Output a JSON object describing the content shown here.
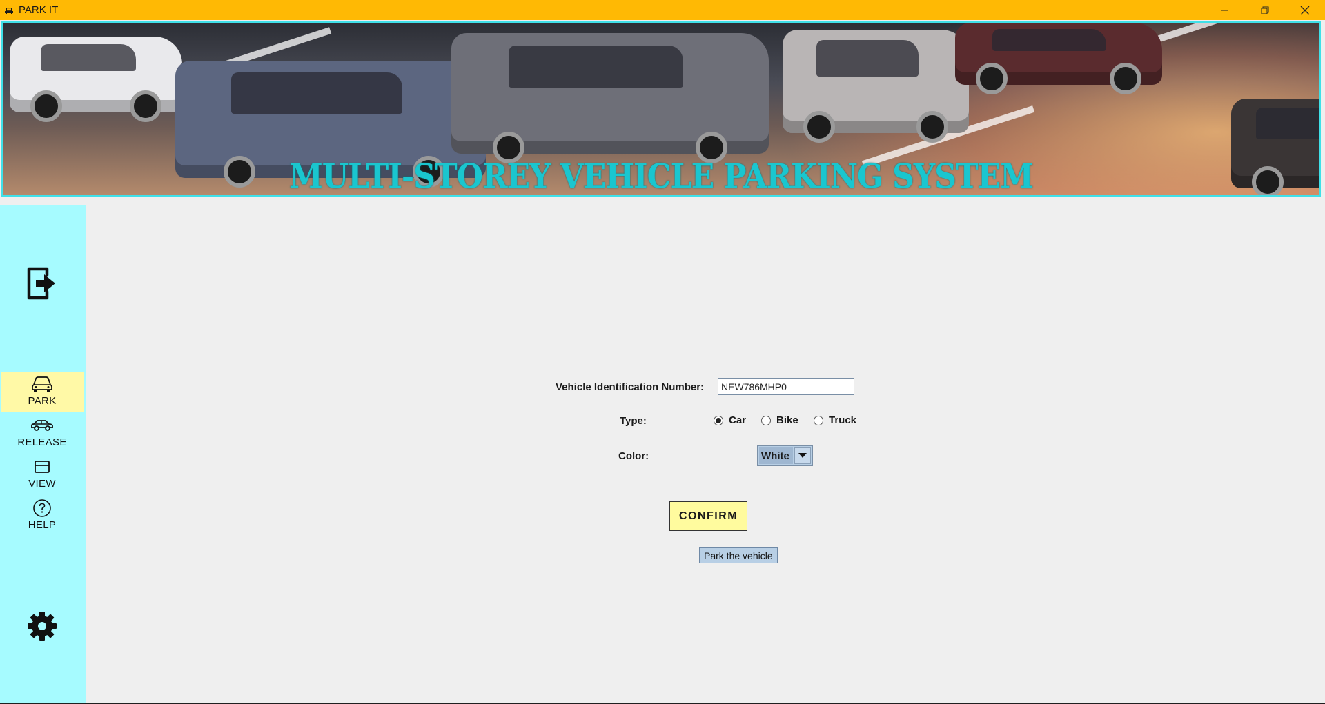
{
  "window": {
    "title": "PARK IT",
    "controls": [
      "minimize-icon",
      "restore-icon",
      "close-icon"
    ]
  },
  "banner": {
    "title": "MULTI-STOREY VEHICLE PARKING SYSTEM"
  },
  "sidebar": {
    "top_icon": "logout-icon",
    "items": [
      {
        "label": "PARK",
        "icon": "car-front-icon",
        "active": true
      },
      {
        "label": "RELEASE",
        "icon": "car-side-icon",
        "active": false
      },
      {
        "label": "VIEW",
        "icon": "list-view-icon",
        "active": false
      },
      {
        "label": "HELP",
        "icon": "help-icon",
        "active": false
      }
    ],
    "bottom_icon": "settings-icon"
  },
  "form": {
    "vin_label": "Vehicle Identification Number:",
    "vin_value": "NEW786MHP0",
    "type_label": "Type:",
    "type_options": [
      {
        "label": "Car",
        "checked": true
      },
      {
        "label": "Bike",
        "checked": false
      },
      {
        "label": "Truck",
        "checked": false
      }
    ],
    "color_label": "Color:",
    "color_value": "White",
    "confirm_label": "CONFIRM",
    "tooltip": "Park the vehicle"
  },
  "colors": {
    "titlebar": "#ffb904",
    "sidebar": "#a6fbff",
    "active_nav": "#fff9a6",
    "banner_title": "#1ac6cf",
    "confirm_bg": "#fffb9e"
  }
}
